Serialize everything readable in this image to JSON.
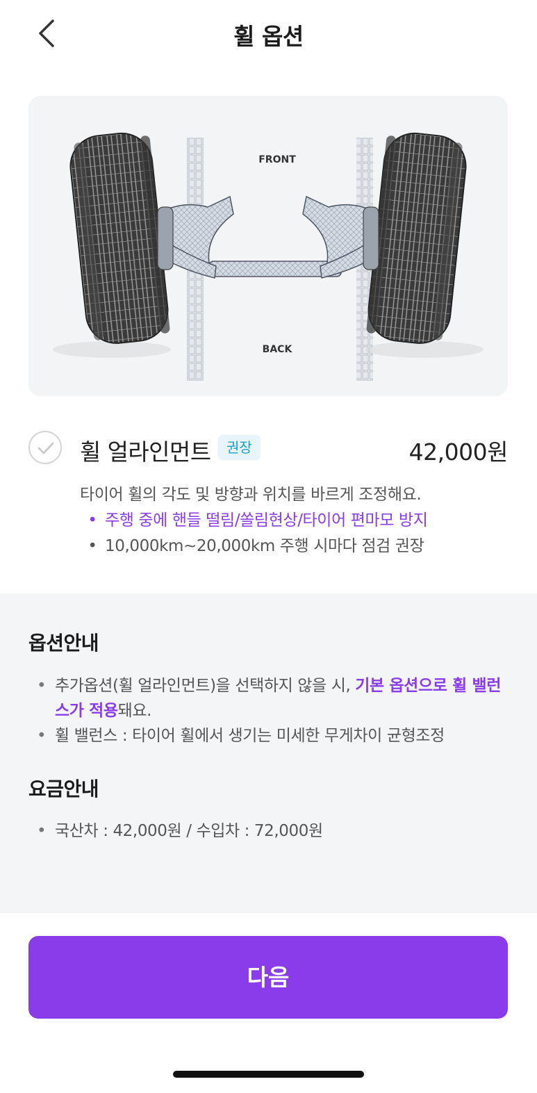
{
  "header": {
    "title": "휠 옵션",
    "back_icon": "chevron-left-icon"
  },
  "hero": {
    "label_front": "FRONT",
    "label_back": "BACK"
  },
  "option": {
    "name": "휠 얼라인먼트",
    "badge": "권장",
    "price": "42,000원",
    "selected": false,
    "description": "타이어 휠의 각도 및 방향과 위치를 바르게 조정해요.",
    "points": [
      {
        "bullet": "•",
        "text": "주행 중에 핸들 떨림/쏠림현상/타이어 편마모 방지"
      },
      {
        "bullet": "•",
        "text": "10,000km~20,000km 주행 시마다 점검 권장"
      }
    ]
  },
  "option_guide": {
    "title": "옵션안내",
    "items": [
      {
        "bullet": "•",
        "text_before": "추가옵션(휠 얼라인먼트)을 선택하지 않을 시, ",
        "text_highlight": "기본 옵션으로 휠 밸런스가 적용",
        "text_after": "돼요."
      },
      {
        "bullet": "•",
        "text": "휠 밸런스 : 타이어 휠에서 생기는 미세한 무게차이 균형조정"
      }
    ]
  },
  "price_guide": {
    "title": "요금안내",
    "items": [
      {
        "bullet": "•",
        "text": "국산차 : 42,000원 / 수입차 : 72,000원"
      }
    ]
  },
  "footer": {
    "next_label": "다음"
  },
  "colors": {
    "accent": "#8a3bea",
    "badge_bg": "#e8f6fb",
    "badge_text": "#1aa2c8",
    "info_bg": "#f4f5f7"
  }
}
